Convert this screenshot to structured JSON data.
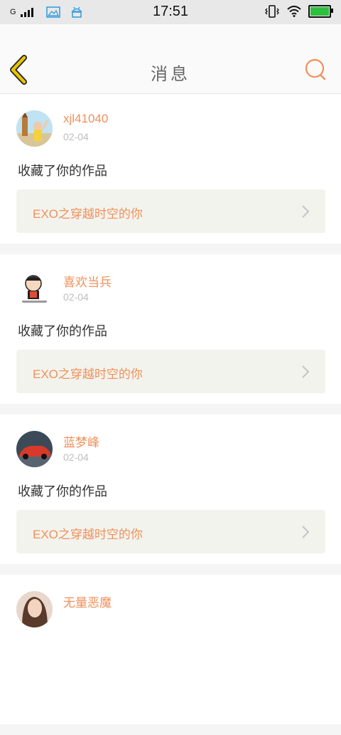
{
  "status_bar": {
    "carrier": "G",
    "time": "17:51",
    "colors": {
      "battery_fill": "#2fbf3f",
      "notif_icons": "#3aa0e0"
    }
  },
  "header": {
    "title": "消息",
    "back_icon": "chevron-left-icon",
    "search_icon": "search-icon",
    "accent_color": "#f0905a",
    "back_icon_colors": [
      "#e7c400",
      "#222222"
    ]
  },
  "messages": [
    {
      "username": "xjl41040",
      "date": "02-04",
      "action": "收藏了你的作品",
      "work_title": "EXO之穿越时空的你"
    },
    {
      "username": "喜欢当兵",
      "date": "02-04",
      "action": "收藏了你的作品",
      "work_title": "EXO之穿越时空的你"
    },
    {
      "username": "蓝梦峰",
      "date": "02-04",
      "action": "收藏了你的作品",
      "work_title": "EXO之穿越时空的你"
    },
    {
      "username": "无量恶魔",
      "date": "",
      "action": "",
      "work_title": ""
    }
  ]
}
